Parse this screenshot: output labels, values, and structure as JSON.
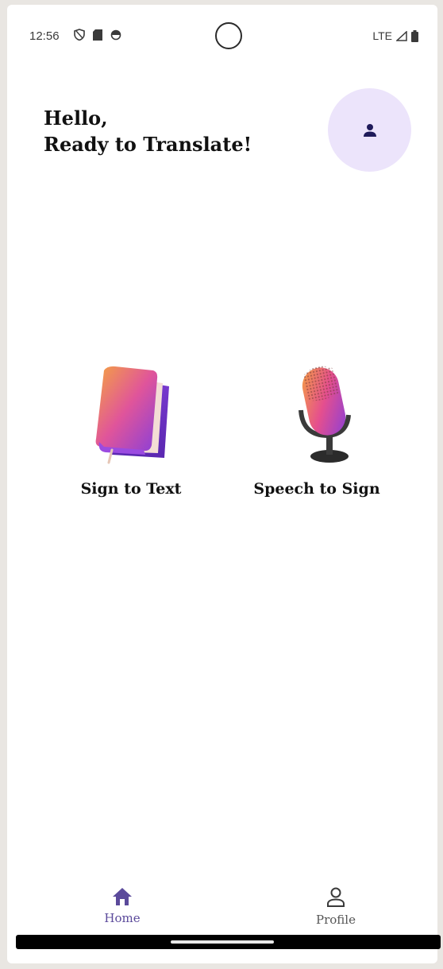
{
  "status_bar": {
    "time": "12:56",
    "network": "LTE"
  },
  "header": {
    "greeting_line1": "Hello,",
    "greeting_line2": "Ready to Translate!",
    "avatar_icon": "person-icon"
  },
  "features": [
    {
      "label": "Sign to Text",
      "icon": "book-icon"
    },
    {
      "label": "Speech to Sign",
      "icon": "microphone-icon"
    }
  ],
  "bottom_nav": {
    "home_label": "Home",
    "profile_label": "Profile"
  },
  "colors": {
    "accent": "#5b4a9b",
    "avatar_bg": "#ece4fb",
    "avatar_icon": "#1f1a5a"
  }
}
